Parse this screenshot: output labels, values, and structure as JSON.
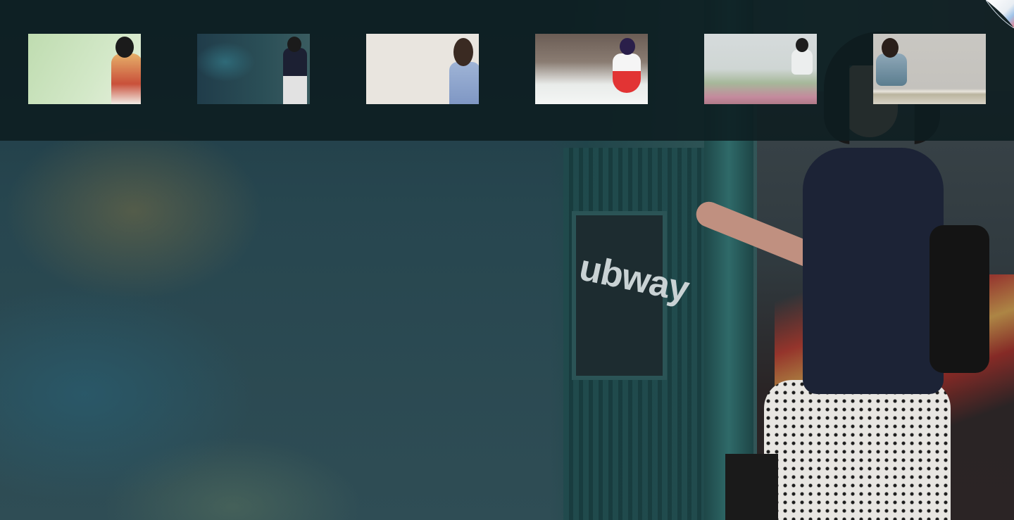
{
  "thumbnails": [
    {
      "icon": "portrait-thumbnail",
      "dominant_color": "#c8e0bb"
    },
    {
      "icon": "portrait-thumbnail",
      "dominant_color": "#2b4f57"
    },
    {
      "icon": "portrait-thumbnail",
      "dominant_color": "#e9e5df"
    },
    {
      "icon": "portrait-thumbnail",
      "dominant_color": "#e9ecea"
    },
    {
      "icon": "portrait-thumbnail",
      "dominant_color": "#cfd6d4"
    },
    {
      "icon": "portrait-thumbnail",
      "dominant_color": "#c6c4bf"
    }
  ],
  "background": {
    "sign_text": "ubway",
    "dominant_color": "#27464f"
  },
  "corner_icon": "page-curl-icon"
}
